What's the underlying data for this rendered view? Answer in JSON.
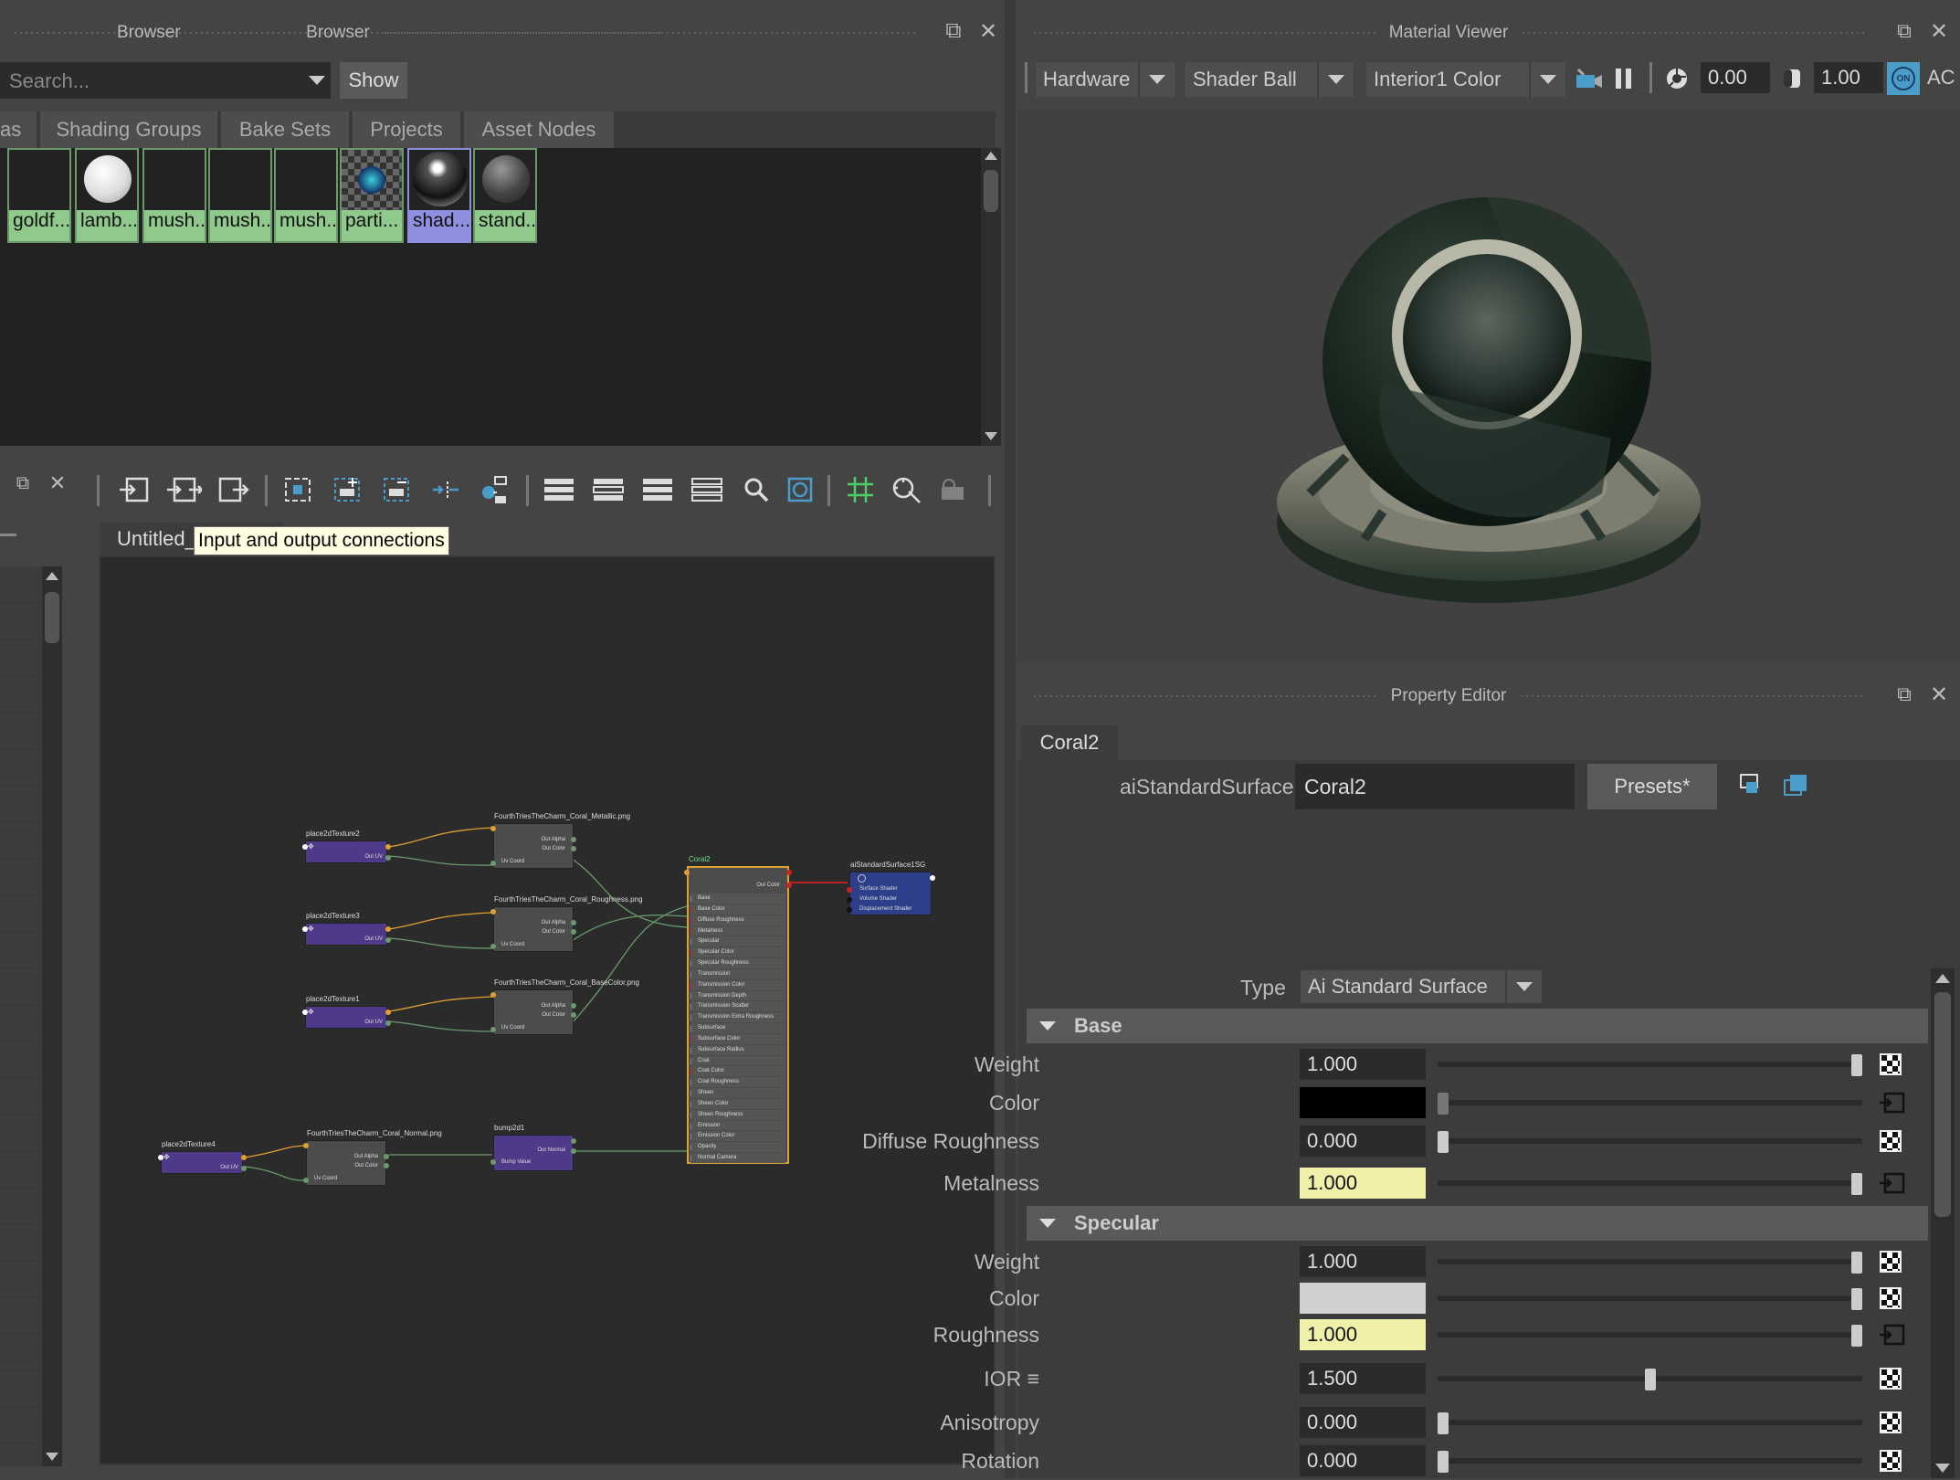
{
  "browser": {
    "title": "Browser",
    "search_placeholder": "Search...",
    "show_label": "Show",
    "tabs": [
      "as",
      "Shading Groups",
      "Bake Sets",
      "Projects",
      "Asset Nodes"
    ],
    "swatches": [
      "goldf...",
      "lamb...",
      "mush...",
      "mush...",
      "mush...",
      "parti...",
      "shad...",
      "stand..."
    ]
  },
  "node_editor": {
    "tab_label": "Untitled_",
    "tooltip": "Input and output connections",
    "nodes": {
      "p2": "place2dTexture2",
      "p3": "place2dTexture3",
      "p1": "place2dTexture1",
      "p4": "place2dTexture4",
      "metallic": "FourthTriesTheCharm_Coral_Metallic.png",
      "rough": "FourthTriesTheCharm_Coral_Roughness.png",
      "base": "FourthTriesTheCharm_Coral_BaseColor.png",
      "normal": "FourthTriesTheCharm_Coral_Normal.png",
      "bump": "bump2d1",
      "coral": "Coral2",
      "sg": "aiStandardSurface1SG"
    },
    "ports": {
      "out_uv": "Out UV",
      "out_alpha": "Out Alpha",
      "out_color": "Out Color",
      "uv_coord": "Uv Coord",
      "out_normal": "Out Normal",
      "bump_value": "Bump Value",
      "coral_out": "Out Color",
      "coral_attrs": [
        "Base",
        "Base Color",
        "Diffuse Roughness",
        "Metalness",
        "Specular",
        "Specular Color",
        "Specular Roughness",
        "Transmission",
        "Transmission Color",
        "Transmission Depth",
        "Transmission Scatter",
        "Transmission Extra Roughness",
        "Subsurface",
        "Subsurface Color",
        "Subsurface Radius",
        "Coat",
        "Coat Color",
        "Coat Roughness",
        "Sheen",
        "Sheen Color",
        "Sheen Roughness",
        "Emission",
        "Emission Color",
        "Opacity",
        "Normal Camera"
      ],
      "sg_attrs": [
        "Surface Shader",
        "Volume Shader",
        "Displacement Shader"
      ]
    }
  },
  "material_viewer": {
    "title": "Material Viewer",
    "renderer": "Hardware",
    "geometry": "Shader Ball",
    "environment": "Interior1 Color",
    "exposure": "0.00",
    "gamma": "1.00",
    "on_label": "ON",
    "ac_label": "AC"
  },
  "property_editor": {
    "title": "Property Editor",
    "tab": "Coral2",
    "node_type_label": "aiStandardSurface:",
    "node_name": "Coral2",
    "presets_label": "Presets*",
    "type_label": "Type",
    "type_value": "Ai Standard Surface",
    "sections": {
      "base": "Base",
      "specular": "Specular"
    },
    "base": {
      "weight_label": "Weight",
      "weight": "1.000",
      "weight_level": 1.0,
      "color_label": "Color",
      "color": "#000000",
      "diffuse_label": "Diffuse Roughness",
      "diffuse": "0.000",
      "diffuse_level": 0.0,
      "metal_label": "Metalness",
      "metal": "1.000",
      "metal_level": 1.0
    },
    "specular": {
      "weight_label": "Weight",
      "weight": "1.000",
      "weight_level": 1.0,
      "color_label": "Color",
      "color": "#d0d0d0",
      "rough_label": "Roughness",
      "rough": "1.000",
      "rough_level": 1.0,
      "ior_label": "IOR ≡",
      "ior": "1.500",
      "ior_level": 0.5,
      "aniso_label": "Anisotropy",
      "aniso": "0.000",
      "aniso_level": 0.0,
      "rot_label": "Rotation",
      "rot": "0.000",
      "rot_level": 0.0
    },
    "highlight_color": "#f0f0a8"
  },
  "colors": {
    "node_purple": "#4f3a8a",
    "node_gray": "#4c4c4c",
    "node_blue": "#2d3f8a",
    "swatch_green": "#8fc98b",
    "swatch_selected": "#8f8fe0",
    "accent": "#4a9cc9"
  }
}
